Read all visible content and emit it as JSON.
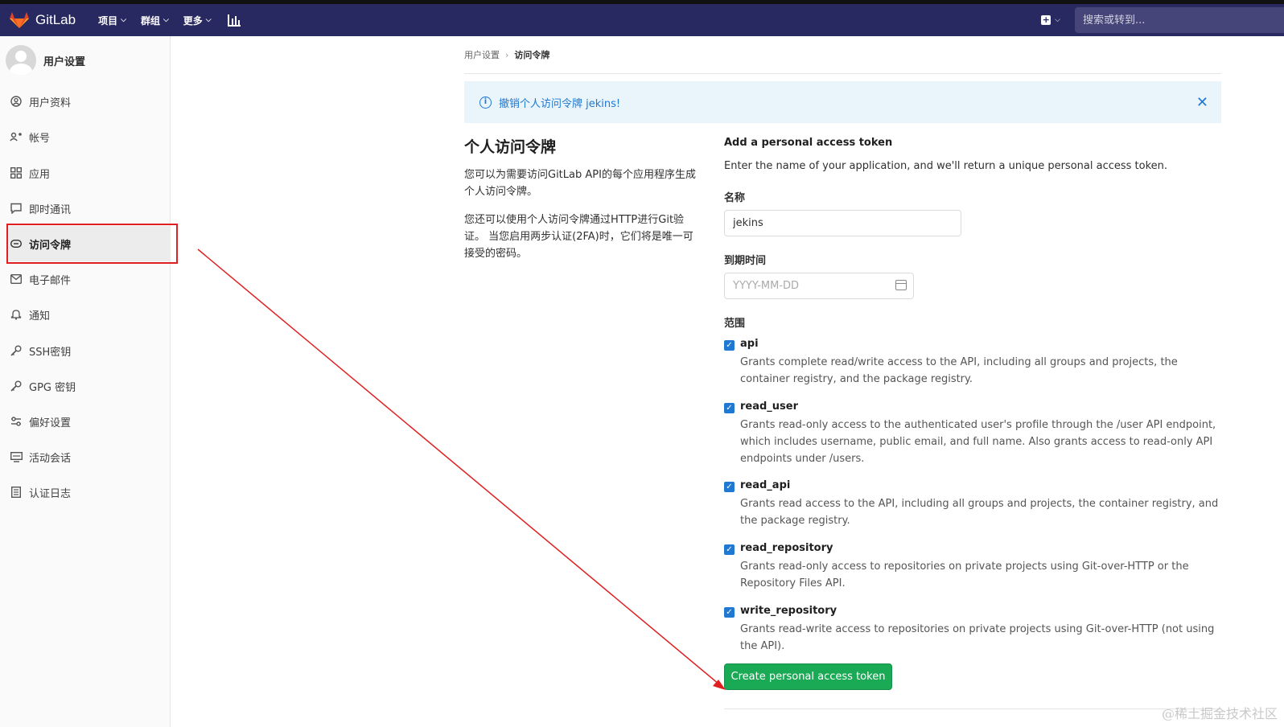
{
  "navbar": {
    "logo_text": "GitLab",
    "items": [
      {
        "label": "项目"
      },
      {
        "label": "群组"
      },
      {
        "label": "更多"
      }
    ],
    "search_placeholder": "搜索或转到..."
  },
  "sidebar": {
    "title": "用户设置",
    "items": [
      {
        "label": "用户资料",
        "icon": "profile-icon"
      },
      {
        "label": "帐号",
        "icon": "account-icon"
      },
      {
        "label": "应用",
        "icon": "applications-icon"
      },
      {
        "label": "即时通讯",
        "icon": "chat-icon"
      },
      {
        "label": "访问令牌",
        "icon": "token-icon",
        "active": true
      },
      {
        "label": "电子邮件",
        "icon": "mail-icon"
      },
      {
        "label": "通知",
        "icon": "bell-icon"
      },
      {
        "label": "SSH密钥",
        "icon": "key-icon"
      },
      {
        "label": "GPG 密钥",
        "icon": "key-icon"
      },
      {
        "label": "偏好设置",
        "icon": "preferences-icon"
      },
      {
        "label": "活动会话",
        "icon": "monitor-icon"
      },
      {
        "label": "认证日志",
        "icon": "log-icon"
      }
    ]
  },
  "breadcrumb": {
    "parent": "用户设置",
    "current": "访问令牌"
  },
  "alert": {
    "message": "撤销个人访问令牌 jekins!"
  },
  "intro": {
    "title": "个人访问令牌",
    "p1": "您可以为需要访问GitLab API的每个应用程序生成个人访问令牌。",
    "p2": "您还可以使用个人访问令牌通过HTTP进行Git验证。 当您启用两步认证(2FA)时，它们将是唯一可接受的密码。"
  },
  "form": {
    "title": "Add a personal access token",
    "description": "Enter the name of your application, and we'll return a unique personal access token.",
    "name_label": "名称",
    "name_value": "jekins",
    "expires_label": "到期时间",
    "expires_placeholder": "YYYY-MM-DD",
    "scopes_label": "范围",
    "scopes": [
      {
        "name": "api",
        "checked": true,
        "desc": "Grants complete read/write access to the API, including all groups and projects, the container registry, and the package registry."
      },
      {
        "name": "read_user",
        "checked": true,
        "desc": "Grants read-only access to the authenticated user's profile through the /user API endpoint, which includes username, public email, and full name. Also grants access to read-only API endpoints under /users."
      },
      {
        "name": "read_api",
        "checked": true,
        "desc": "Grants read access to the API, including all groups and projects, the container registry, and the package registry."
      },
      {
        "name": "read_repository",
        "checked": true,
        "desc": "Grants read-only access to repositories on private projects using Git-over-HTTP or the Repository Files API."
      },
      {
        "name": "write_repository",
        "checked": true,
        "desc": "Grants read-write access to repositories on private projects using Git-over-HTTP (not using the API)."
      }
    ],
    "submit_label": "Create personal access token"
  },
  "colors": {
    "navbar": "#292961",
    "accent": "#1f78d1",
    "success": "#1aaa55",
    "annotation": "#e02020"
  },
  "watermark": "@稀土掘金技术社区"
}
